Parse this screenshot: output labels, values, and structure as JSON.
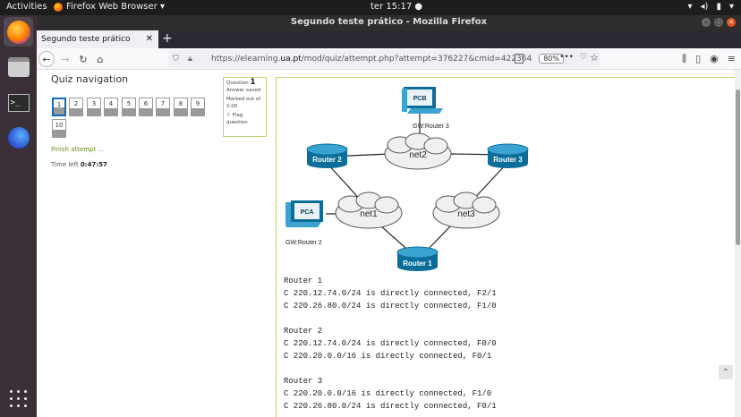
{
  "system": {
    "activities": "Activities",
    "app_name": "Firefox Web Browser ▾",
    "clock": "ter 15:17 ●"
  },
  "window": {
    "title": "Segundo teste prático - Mozilla Firefox"
  },
  "tab": {
    "label": "Segundo teste prático",
    "close": "✕",
    "new_tab": "+"
  },
  "url": {
    "prefix": "https://elearning.",
    "domain": "ua.pt",
    "suffix": "/mod/quiz/attempt.php?attempt=376227&cmid=422364",
    "zoom": "80%"
  },
  "quiz_nav": {
    "title": "Quiz navigation",
    "buttons": [
      "1",
      "2",
      "3",
      "4",
      "5",
      "6",
      "7",
      "8",
      "9",
      "10"
    ],
    "finish": "Finish attempt ...",
    "time_left_label": "Time left",
    "time_left_value": "0:47:57"
  },
  "question_info": {
    "question_label": "Question",
    "number": "1",
    "status": "Answer saved",
    "marked": "Marked out of 2.00",
    "flag": "Flag question"
  },
  "diagram": {
    "pcb": "PCB",
    "pcb_gw": "GW:Router 3",
    "pca": "PCA",
    "pca_gw": "GW:Router 2",
    "router1": "Router 1",
    "router2": "Router 2",
    "router3": "Router 3",
    "net1": "net1",
    "net2": "net2",
    "net3": "net3"
  },
  "routing": {
    "r1_title": "Router 1",
    "r1_l1": "C 220.12.74.0/24 is directly connected, F2/1",
    "r1_l2": "C 220.26.80.0/24 is directly connected, F1/0",
    "r2_title": "Router 2",
    "r2_l1": "C 220.12.74.0/24 is directly connected, F0/0",
    "r2_l2": "C 220.20.0.0/16 is directly connected, F0/1",
    "r3_title": "Router 3",
    "r3_l1": "C 220.20.0.0/16 is directly connected, F1/0",
    "r3_l2": "C 220.26.80.0/24 is directly connected, F0/1"
  }
}
